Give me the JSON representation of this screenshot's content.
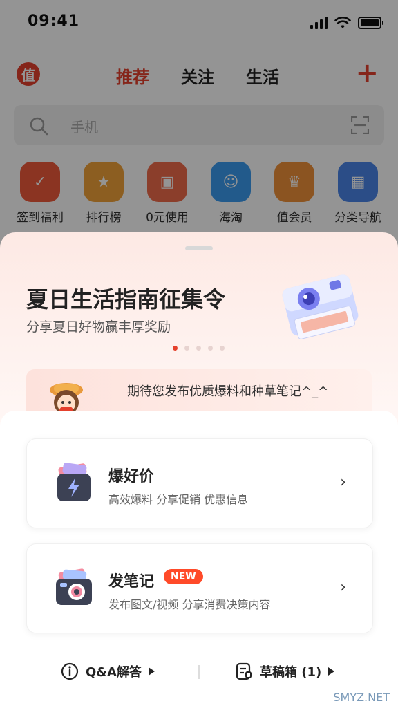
{
  "status_bar": {
    "time": "09:41"
  },
  "top_nav": {
    "logo_text": "值",
    "tabs": [
      "推荐",
      "关注",
      "生活"
    ],
    "active_tab": "推荐",
    "plus_icon": "plus-icon"
  },
  "search": {
    "placeholder": "手机"
  },
  "quick_entries": [
    {
      "label": "签到福利",
      "icon": "gift-icon",
      "color": "#f05a3b"
    },
    {
      "label": "排行榜",
      "icon": "trophy-icon",
      "color": "#f2a23a"
    },
    {
      "label": "0元使用",
      "icon": "box-icon",
      "color": "#f06b4a"
    },
    {
      "label": "海淘",
      "icon": "tv-face-icon",
      "color": "#3b9bf0"
    },
    {
      "label": "值会员",
      "icon": "crown-icon",
      "color": "#f0913a"
    },
    {
      "label": "分类导航",
      "icon": "grid-icon",
      "color": "#4a86e8"
    }
  ],
  "sheet": {
    "banner": {
      "title": "夏日生活指南征集令",
      "subtitle": "分享夏日好物赢丰厚奖励",
      "dots_total": 5,
      "active_dot": 1
    },
    "hint": "期待您发布优质爆料和种草笔记^_^",
    "cards": [
      {
        "title": "爆好价",
        "desc": "高效爆料 分享促销 优惠信息",
        "icon": "lightning-box-icon"
      },
      {
        "title": "发笔记",
        "desc": "发布图文/视频 分享消费决策内容",
        "badge": "NEW",
        "icon": "camera-icon"
      }
    ],
    "footer": {
      "qa_label": "Q&A解答",
      "draft_label": "草稿箱 (1)"
    }
  },
  "watermark": "SMYZ.NET",
  "colors": {
    "accent": "#e5412d",
    "badge": "#ff4a29"
  }
}
